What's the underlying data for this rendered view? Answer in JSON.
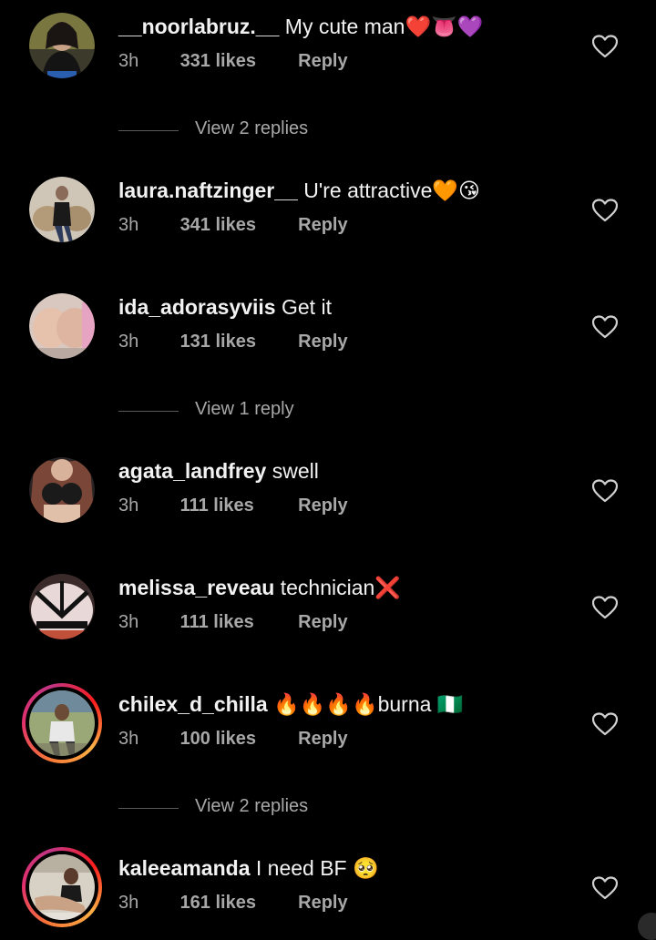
{
  "comments": [
    {
      "username": "__noorlabruz.__",
      "text": "My cute man",
      "emoji": "❤️👅💜",
      "time": "3h",
      "likes": "331 likes",
      "reply": "Reply",
      "avatar": "avatar-photo"
    },
    {
      "username": "laura.naftzinger__",
      "text": "U're attractive",
      "emoji": "🧡😘",
      "time": "3h",
      "likes": "341 likes",
      "reply": "Reply",
      "avatar": "avatar-photo"
    },
    {
      "username": "ida_adorasyviis",
      "text": "Get it",
      "emoji": "",
      "time": "3h",
      "likes": "131 likes",
      "reply": "Reply",
      "avatar": "avatar-photo"
    },
    {
      "username": "agata_landfrey",
      "text": "swell",
      "emoji": "",
      "time": "3h",
      "likes": "111 likes",
      "reply": "Reply",
      "avatar": "avatar-photo"
    },
    {
      "username": "melissa_reveau",
      "text": "technician",
      "emoji": "❌",
      "time": "3h",
      "likes": "111 likes",
      "reply": "Reply",
      "avatar": "avatar-photo"
    },
    {
      "username": "chilex_d_chilla",
      "text": "burna",
      "emoji_before": "🔥🔥🔥🔥",
      "emoji": "🇳🇬",
      "time": "3h",
      "likes": "100 likes",
      "reply": "Reply",
      "avatar": "avatar-photo-story-ring"
    },
    {
      "username": "kaleeamanda",
      "text": "I need BF",
      "emoji": "🥺",
      "time": "3h",
      "likes": "161 likes",
      "reply": "Reply",
      "avatar": "avatar-photo-story-ring"
    }
  ],
  "view_replies": [
    {
      "label": "View 2 replies"
    },
    {
      "label": "View 1 reply"
    },
    {
      "label": "View 2 replies"
    }
  ],
  "icons": {
    "like": "heart-outline-icon"
  },
  "colors": {
    "background": "#000000",
    "text_primary": "#f5f5f5",
    "text_secondary": "#a8a8a8",
    "story_ring": "#e1306c"
  }
}
